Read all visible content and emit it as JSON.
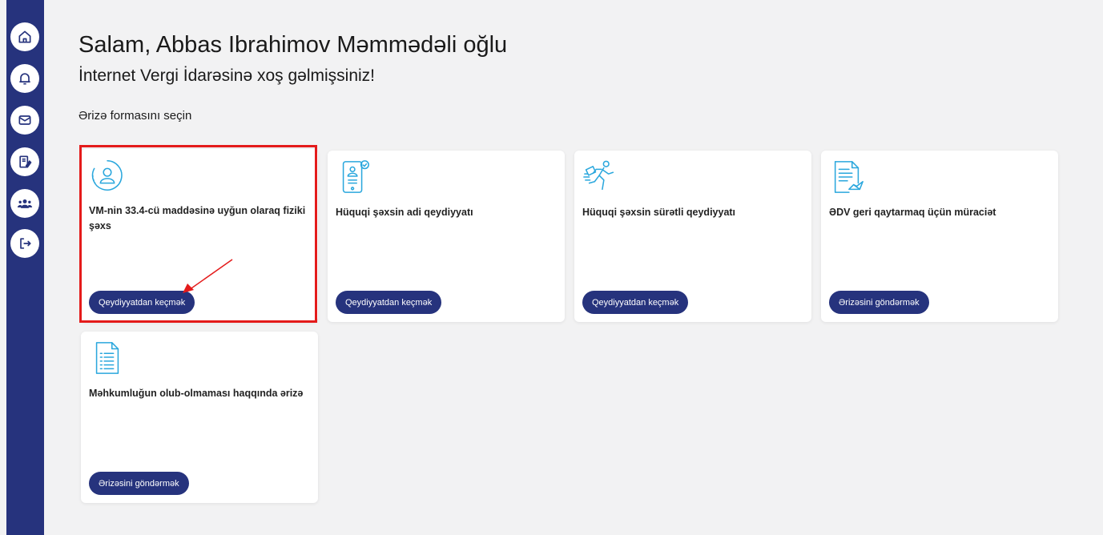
{
  "sidebar": {
    "items": [
      {
        "name": "home",
        "icon": "home-icon"
      },
      {
        "name": "notifications",
        "icon": "bell-icon"
      },
      {
        "name": "messages",
        "icon": "mail-icon"
      },
      {
        "name": "documents",
        "icon": "document-edit-icon"
      },
      {
        "name": "users",
        "icon": "users-icon"
      },
      {
        "name": "logout",
        "icon": "logout-icon"
      }
    ]
  },
  "header": {
    "greeting": "Salam, Abbas Ibrahimov Məmmədəli oğlu",
    "welcome": "İnternet Vergi İdarəsinə xoş gəlmişsiniz!",
    "form_label": "Ərizə formasını seçin"
  },
  "cards": [
    {
      "icon": "user-circle-icon",
      "title": "VM-nin 33.4-cü maddəsinə uyğun olaraq fiziki şəxs",
      "button": "Qeydiyyatdan keçmək"
    },
    {
      "icon": "id-card-icon",
      "title": "Hüquqi şəxsin adi qeydiyyatı",
      "button": "Qeydiyyatdan keçmək"
    },
    {
      "icon": "running-person-icon",
      "title": "Hüquqi şəxsin sürətli qeydiyyatı",
      "button": "Qeydiyyatdan keçmək"
    },
    {
      "icon": "document-send-icon",
      "title": "ƏDV geri qaytarmaq üçün müraciət",
      "button": "Ərizəsini göndərmək"
    },
    {
      "icon": "document-list-icon",
      "title": "Məhkumluğun olub-olmaması haqqında ərizə",
      "button": "Ərizəsini göndərmək"
    }
  ],
  "colors": {
    "sidebar": "#26337d",
    "button": "#26337d",
    "icon": "#2aa7dd",
    "highlight": "#e41b1b",
    "background": "#f2f2f3"
  }
}
